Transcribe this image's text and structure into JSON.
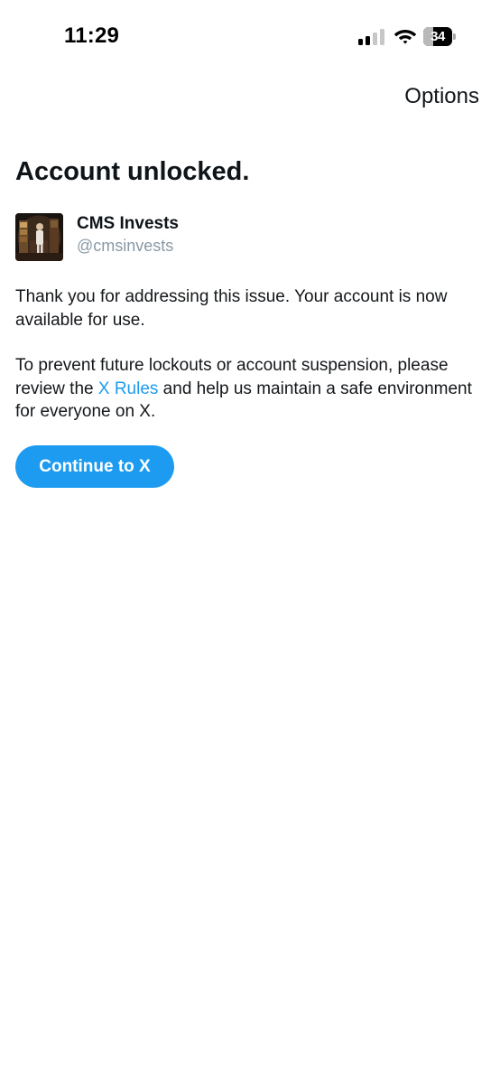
{
  "status_bar": {
    "time": "11:29",
    "battery_level": "34",
    "signal_bars_active": 2,
    "signal_bars_total": 4,
    "icons": [
      "cellular-signal-icon",
      "wifi-icon",
      "battery-icon"
    ]
  },
  "header": {
    "options_label": "Options"
  },
  "main": {
    "title": "Account unlocked.",
    "account": {
      "display_name": "CMS Invests",
      "handle": "@cmsinvests"
    },
    "message_1": "Thank you for addressing this issue. Your account is now available for use.",
    "message_2_before_link": "To prevent future lockouts or account suspension, please review the ",
    "message_2_link": "X Rules",
    "message_2_after_link": " and help us maintain a safe environment for everyone on X.",
    "continue_label": "Continue to X"
  },
  "colors": {
    "accent": "#1d9bf0",
    "text_primary": "#0f1419",
    "text_secondary": "#8899a6",
    "background": "#ffffff"
  }
}
